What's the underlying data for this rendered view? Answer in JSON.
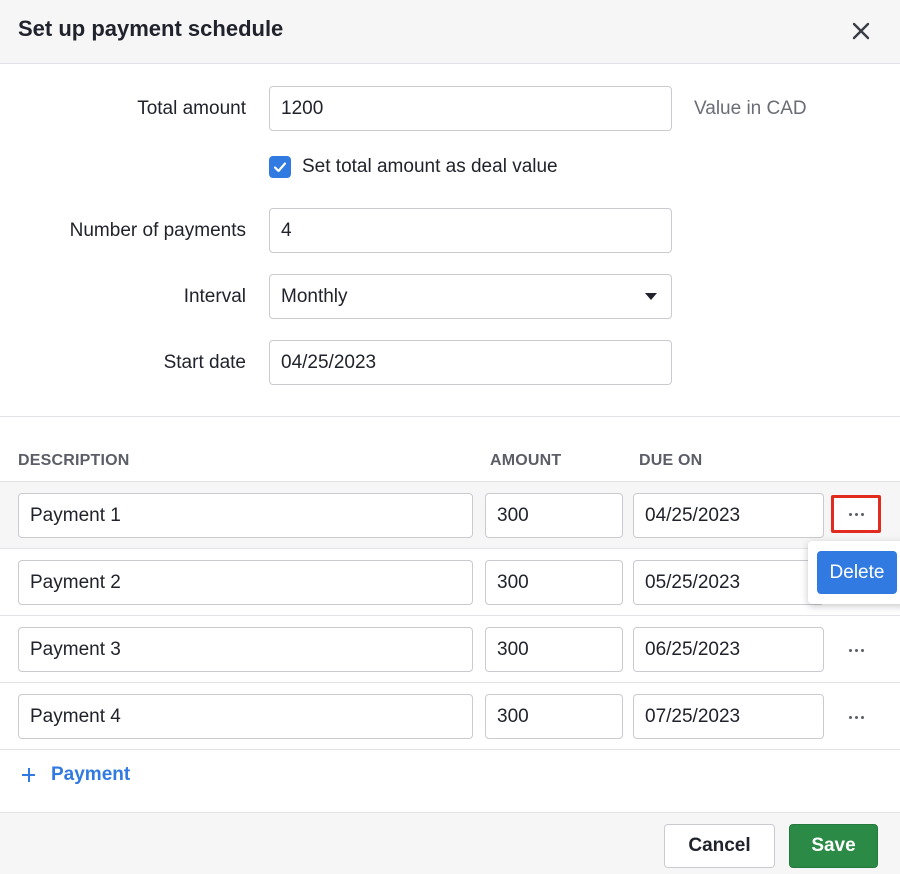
{
  "dialog": {
    "title": "Set up payment schedule",
    "close_icon": "close-icon"
  },
  "form": {
    "total_amount_label": "Total amount",
    "total_amount_value": "1200",
    "currency_hint": "Value in CAD",
    "deal_value_checkbox_label": "Set total amount as deal value",
    "deal_value_checked": true,
    "num_payments_label": "Number of payments",
    "num_payments_value": "4",
    "interval_label": "Interval",
    "interval_value": "Monthly",
    "start_date_label": "Start date",
    "start_date_value": "04/25/2023"
  },
  "table": {
    "headers": {
      "description": "DESCRIPTION",
      "amount": "AMOUNT",
      "due_on": "DUE ON"
    },
    "rows": [
      {
        "description": "Payment 1",
        "amount": "300",
        "due_on": "04/25/2023"
      },
      {
        "description": "Payment 2",
        "amount": "300",
        "due_on": "05/25/2023"
      },
      {
        "description": "Payment 3",
        "amount": "300",
        "due_on": "06/25/2023"
      },
      {
        "description": "Payment 4",
        "amount": "300",
        "due_on": "07/25/2023"
      }
    ],
    "row_menu": {
      "delete_label": "Delete"
    },
    "add_payment_label": "Payment"
  },
  "footer": {
    "cancel_label": "Cancel",
    "save_label": "Save"
  },
  "colors": {
    "accent_blue": "#317ae2",
    "save_green": "#2a8a46",
    "highlight_red": "#e12b1e"
  }
}
